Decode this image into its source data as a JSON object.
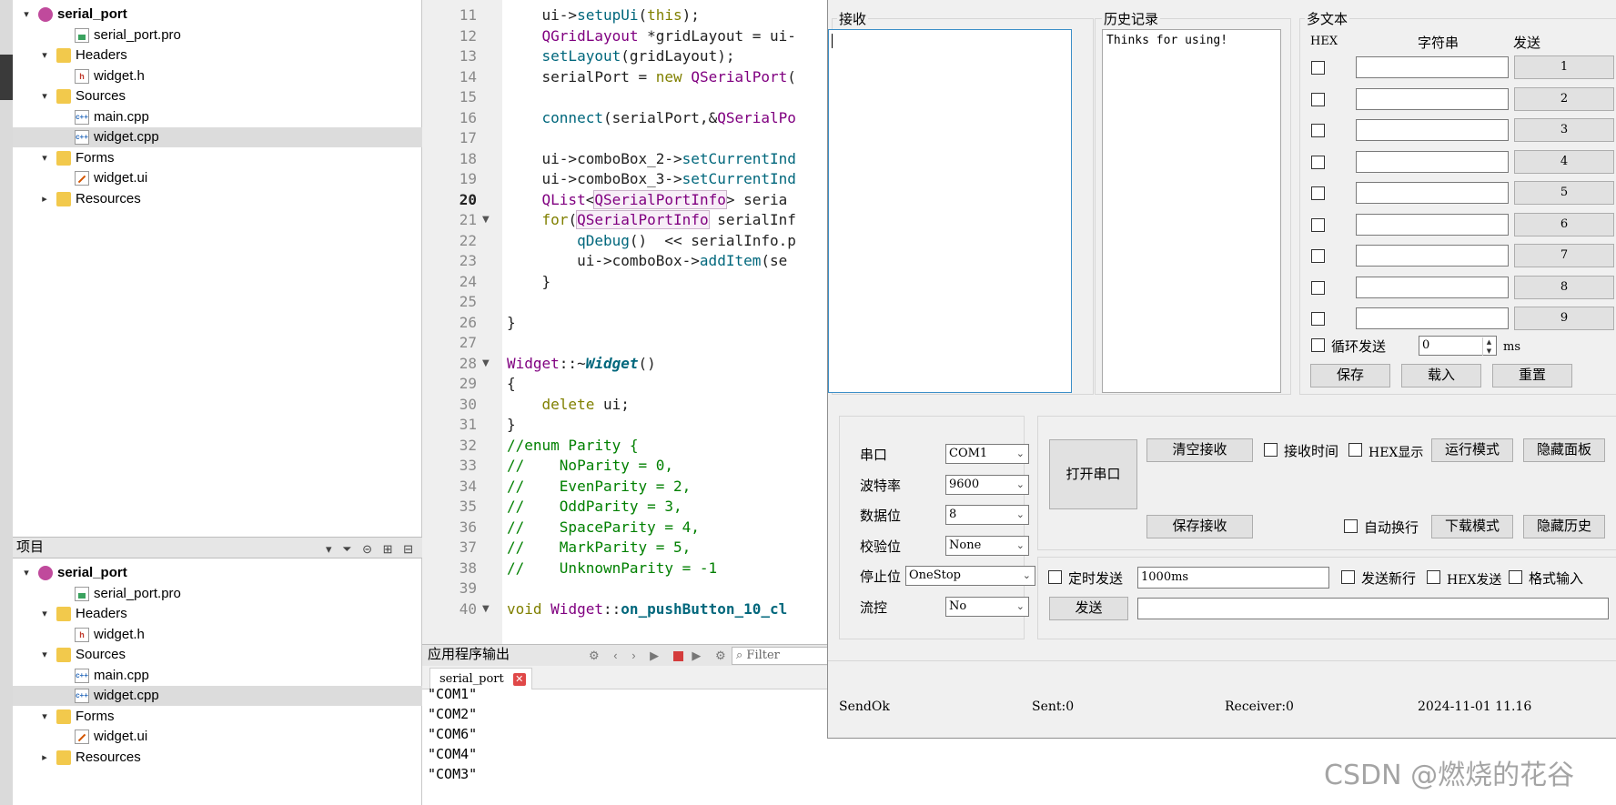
{
  "project_tree": {
    "items": [
      {
        "label": "serial_port",
        "type": "project",
        "bold": true,
        "arrow": "▾"
      },
      {
        "label": "serial_port.pro",
        "type": "pro"
      },
      {
        "label": "Headers",
        "type": "folder",
        "arrow": "▾"
      },
      {
        "label": "widget.h",
        "type": "h"
      },
      {
        "label": "Sources",
        "type": "folder",
        "arrow": "▾"
      },
      {
        "label": "main.cpp",
        "type": "cpp"
      },
      {
        "label": "widget.cpp",
        "type": "cpp",
        "selected": true
      },
      {
        "label": "Forms",
        "type": "folder",
        "arrow": "▾"
      },
      {
        "label": "widget.ui",
        "type": "ui"
      },
      {
        "label": "Resources",
        "type": "folder",
        "arrow": "▸"
      }
    ]
  },
  "projects_pane": {
    "title": "项目",
    "items": [
      {
        "label": "serial_port",
        "type": "project",
        "bold": true,
        "arrow": "▾"
      },
      {
        "label": "serial_port.pro",
        "type": "pro"
      },
      {
        "label": "Headers",
        "type": "folder",
        "arrow": "▾"
      },
      {
        "label": "widget.h",
        "type": "h"
      },
      {
        "label": "Sources",
        "type": "folder",
        "arrow": "▾"
      },
      {
        "label": "main.cpp",
        "type": "cpp"
      },
      {
        "label": "widget.cpp",
        "type": "cpp",
        "selected": true
      },
      {
        "label": "Forms",
        "type": "folder",
        "arrow": "▾"
      },
      {
        "label": "widget.ui",
        "type": "ui"
      },
      {
        "label": "Resources",
        "type": "folder",
        "arrow": "▸"
      }
    ]
  },
  "editor": {
    "current_line": 20,
    "lines": [
      {
        "n": 11,
        "html": "    ui-><span class=\"fn\">setupUi</span>(<span class=\"kw\">this</span>);"
      },
      {
        "n": 12,
        "html": "    <span class=\"ty\">QGridLayout</span> *gridLayout = ui-"
      },
      {
        "n": 13,
        "html": "    <span class=\"fn\">setLayout</span>(gridLayout);"
      },
      {
        "n": 14,
        "html": "    serialPort = <span class=\"kw\">new</span> <span class=\"ty\">QSerialPort</span>("
      },
      {
        "n": 15,
        "html": ""
      },
      {
        "n": 16,
        "html": "    <span class=\"fn\">connect</span>(serialPort,&amp;<span class=\"ty\">QSerialPo</span>"
      },
      {
        "n": 17,
        "html": ""
      },
      {
        "n": 18,
        "html": "    ui->comboBox_2-><span class=\"fn\">setCurrentInd</span>"
      },
      {
        "n": 19,
        "html": "    ui->comboBox_3-><span class=\"fn\">setCurrentInd</span>"
      },
      {
        "n": 20,
        "html": "    <span class=\"ty\">QList</span>&lt;<span class=\"ty hl\">QSerialPortInfo</span>&gt; seria"
      },
      {
        "n": 21,
        "html": "    <span class=\"kw\">for</span>(<span class=\"ty hl\">QSerialPortInfo</span> serialInf",
        "fold": "▼"
      },
      {
        "n": 22,
        "html": "        <span class=\"fn\">qDebug</span>()  &lt;&lt; serialInfo.p"
      },
      {
        "n": 23,
        "html": "        ui->comboBox-><span class=\"fn\">addItem</span>(se"
      },
      {
        "n": 24,
        "html": "    }"
      },
      {
        "n": 25,
        "html": ""
      },
      {
        "n": 26,
        "html": "}"
      },
      {
        "n": 27,
        "html": ""
      },
      {
        "n": 28,
        "html": "<span class=\"ty\">Widget</span>::~<span class=\"em\">Widget</span>()",
        "fold": "▼"
      },
      {
        "n": 29,
        "html": "{"
      },
      {
        "n": 30,
        "html": "    <span class=\"kw\">delete</span> ui;"
      },
      {
        "n": 31,
        "html": "}"
      },
      {
        "n": 32,
        "html": "<span class=\"cm\">//enum Parity {</span>"
      },
      {
        "n": 33,
        "html": "<span class=\"cm\">//    NoParity = 0,</span>"
      },
      {
        "n": 34,
        "html": "<span class=\"cm\">//    EvenParity = 2,</span>"
      },
      {
        "n": 35,
        "html": "<span class=\"cm\">//    OddParity = 3,</span>"
      },
      {
        "n": 36,
        "html": "<span class=\"cm\">//    SpaceParity = 4,</span>"
      },
      {
        "n": 37,
        "html": "<span class=\"cm\">//    MarkParity = 5,</span>"
      },
      {
        "n": 38,
        "html": "<span class=\"cm\">//    UnknownParity = -1</span>"
      },
      {
        "n": 39,
        "html": ""
      },
      {
        "n": 40,
        "html": "<span class=\"kw\">void</span> <span class=\"ty\">Widget</span>::<span class=\"fn\"><b>on_pushButton_10_cl</b></span>",
        "fold": "▼"
      }
    ]
  },
  "output": {
    "title": "应用程序输出",
    "filter_placeholder": "Filter",
    "tab_label": "serial_port",
    "lines": [
      "\"COM1\"",
      "\"COM2\"",
      "\"COM6\"",
      "\"COM4\"",
      "\"COM3\""
    ]
  },
  "serial_window": {
    "receive_title": "接收",
    "history_title": "历史记录",
    "history_text": "Thinks for using!",
    "multitext_title": "多文本",
    "col_hex": "HEX",
    "col_string": "字符串",
    "col_send": "发送",
    "send_buttons": [
      "1",
      "2",
      "3",
      "4",
      "5",
      "6",
      "7",
      "8",
      "9"
    ],
    "loop_send_label": "循环发送",
    "loop_interval_value": "0",
    "loop_unit": "ms",
    "save_label": "保存",
    "load_label": "载入",
    "reset_label": "重置",
    "settings": [
      {
        "label": "串口",
        "value": "COM1"
      },
      {
        "label": "波特率",
        "value": "9600"
      },
      {
        "label": "数据位",
        "value": "8"
      },
      {
        "label": "校验位",
        "value": "None"
      },
      {
        "label": "停止位",
        "value": "OneStop"
      },
      {
        "label": "流控",
        "value": "No"
      }
    ],
    "open_port_label": "打开串口",
    "clear_receive_label": "清空接收",
    "receive_time_label": "接收时间",
    "hex_display_label": "HEX显示",
    "run_mode_label": "运行模式",
    "hide_panel_label": "隐藏面板",
    "save_receive_label": "保存接收",
    "auto_newline_label": "自动换行",
    "download_mode_label": "下载模式",
    "hide_history_label": "隐藏历史",
    "timed_send_label": "定时发送",
    "timed_interval_value": "1000ms",
    "send_newline_label": "发送新行",
    "hex_send_label": "HEX发送",
    "format_input_label": "格式输入",
    "send_label": "发送",
    "status_sendok": "SendOk",
    "status_sent": "Sent:0",
    "status_receiver": "Receiver:0",
    "status_time": "2024-11-01 11.16"
  },
  "watermark": "CSDN @燃烧的花谷"
}
